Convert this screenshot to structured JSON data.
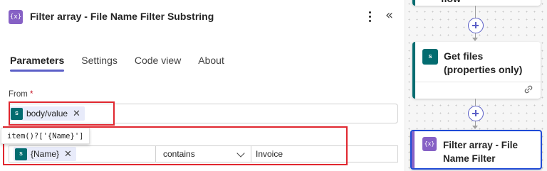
{
  "panel": {
    "icon_glyph": "{x}",
    "title": "Filter array - File Name Filter Substring",
    "more_glyph": "⋮",
    "collapse_glyph": "«",
    "tabs": [
      {
        "label": "Parameters",
        "active": true
      },
      {
        "label": "Settings",
        "active": false
      },
      {
        "label": "Code view",
        "active": false
      },
      {
        "label": "About",
        "active": false
      }
    ],
    "from": {
      "label": "From",
      "required_mark": "*",
      "token": {
        "icon": "sharepoint-icon",
        "icon_text": "S",
        "label": "body/value",
        "remove": "✕"
      }
    },
    "tooltip": "item()?['{Name}']",
    "condition": {
      "left_token": {
        "icon": "sharepoint-icon",
        "icon_text": "S",
        "label": "{Name}",
        "remove": "✕"
      },
      "operator": "contains",
      "right_value": "Invoice"
    }
  },
  "canvas": {
    "top_card_title": "flow",
    "get_files": {
      "icon_text": "S",
      "title": "Get files (properties only)"
    },
    "filter_card": {
      "icon_text": "{x}",
      "title": "Filter array - File Name Filter Substring"
    }
  },
  "colors": {
    "accent": "#5b5fc7",
    "sharepoint": "#036c70",
    "data_operation": "#8661c5",
    "highlight_red": "#e0272f",
    "selected_blue": "#1f4bd6"
  }
}
